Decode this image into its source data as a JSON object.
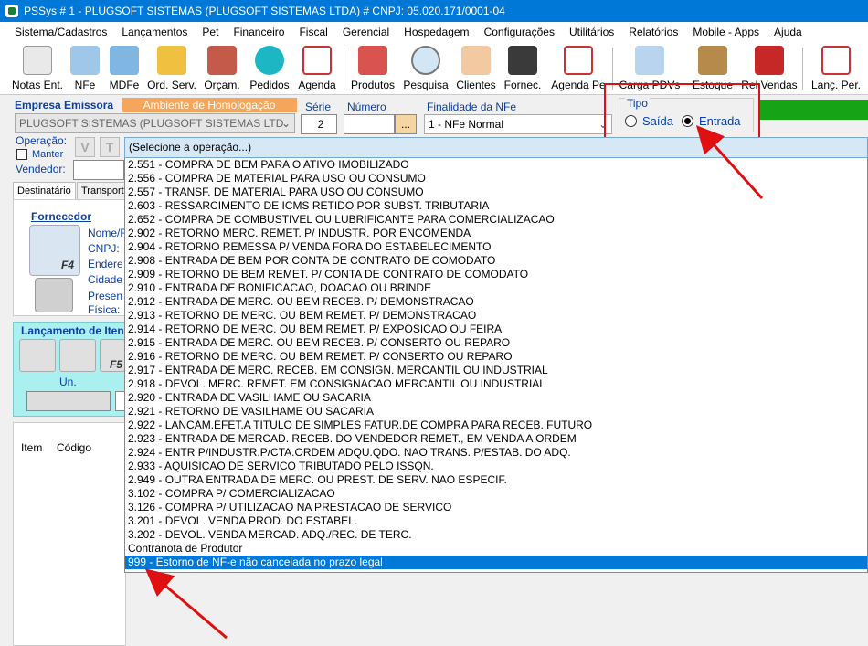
{
  "window": {
    "title": "PSSys # 1 - PLUGSOFT SISTEMAS (PLUGSOFT SISTEMAS LTDA) # CNPJ: 05.020.171/0001-04"
  },
  "menu": [
    "Sistema/Cadastros",
    "Lançamentos",
    "Pet",
    "Financeiro",
    "Fiscal",
    "Gerencial",
    "Hospedagem",
    "Configurações",
    "Utilitários",
    "Relatórios",
    "Mobile - Apps",
    "Ajuda"
  ],
  "toolbar": [
    {
      "label": "Notas Ent.",
      "icon": "notas-entrada-icon"
    },
    {
      "label": "NFe",
      "icon": "nfe-icon"
    },
    {
      "label": "MDFe",
      "icon": "mdfe-icon"
    },
    {
      "label": "Ord. Serv.",
      "icon": "ordem-servico-icon"
    },
    {
      "label": "Orçam.",
      "icon": "orcamento-icon"
    },
    {
      "label": "Pedidos",
      "icon": "pedidos-icon"
    },
    {
      "label": "Agenda",
      "icon": "calendar-icon"
    },
    {
      "label": "Produtos",
      "icon": "cart-icon"
    },
    {
      "label": "Pesquisa",
      "icon": "magnifier-icon"
    },
    {
      "label": "Clientes",
      "icon": "clients-icon"
    },
    {
      "label": "Fornec.",
      "icon": "suppliers-icon"
    },
    {
      "label": "Agenda Pe",
      "icon": "calendar-icon"
    },
    {
      "label": "Carga PDVs",
      "icon": "network-icon"
    },
    {
      "label": "Estoque",
      "icon": "boxes-icon"
    },
    {
      "label": "Rel Vendas",
      "icon": "chart-icon"
    },
    {
      "label": "Lanç. Per.",
      "icon": "calendar-pen-icon"
    }
  ],
  "form": {
    "empresa_label": "Empresa Emissora",
    "ambiente": "Ambiente de Homologação",
    "empresa_value": "PLUGSOFT SISTEMAS  (PLUGSOFT SISTEMAS LTD",
    "serie_label": "Série",
    "serie_value": "2",
    "numero_label": "Número",
    "numero_value": "",
    "numero_btn": "...",
    "finalidade_label": "Finalidade da NFe",
    "finalidade_value": "1 - NFe Normal",
    "tipo_label": "Tipo",
    "tipo_saida": "Saída",
    "tipo_entrada": "Entrada",
    "tipo_selected": "Entrada",
    "operacao_label": "Operação:",
    "manter_label": "Manter",
    "vendedor_label": "Vendedor:",
    "btn_v": "V",
    "btn_t": "T",
    "tab_destinatario": "Destinatário",
    "tab_transport": "Transport",
    "fornecedor_label": "Fornecedor",
    "fields": [
      "Nome/F",
      "CNPJ:",
      "Endere",
      "Cidade",
      "Presen",
      "Física:"
    ],
    "f4_label": "F4",
    "lancamento_label": "Lançamento de Iten",
    "un_label": "Un.",
    "f5_label": "F5",
    "grid_cols": [
      "Item",
      "Código"
    ]
  },
  "dropdown": {
    "header": "(Selecione a operação...)",
    "options": [
      "2.551 - COMPRA DE BEM PARA O ATIVO IMOBILIZADO",
      "2.556 - COMPRA DE MATERIAL PARA USO OU CONSUMO",
      "2.557 - TRANSF. DE MATERIAL PARA USO OU CONSUMO",
      "2.603 - RESSARCIMENTO DE ICMS RETIDO POR SUBST. TRIBUTARIA",
      "2.652 - COMPRA DE COMBUSTIVEL OU LUBRIFICANTE PARA COMERCIALIZACAO",
      "2.902 - RETORNO MERC. REMET. P/ INDUSTR. POR ENCOMENDA",
      "2.904 - RETORNO REMESSA P/ VENDA FORA DO ESTABELECIMENTO",
      "2.908 - ENTRADA DE BEM POR CONTA DE CONTRATO DE COMODATO",
      "2.909 - RETORNO DE BEM REMET. P/ CONTA DE CONTRATO DE COMODATO",
      "2.910 - ENTRADA DE BONIFICACAO, DOACAO OU BRINDE",
      "2.912 - ENTRADA DE MERC. OU BEM RECEB. P/ DEMONSTRACAO",
      "2.913 - RETORNO DE MERC. OU BEM REMET. P/ DEMONSTRACAO",
      "2.914 - RETORNO DE MERC. OU BEM REMET. P/ EXPOSICAO OU FEIRA",
      "2.915 - ENTRADA DE MERC. OU BEM RECEB. P/ CONSERTO OU REPARO",
      "2.916 - RETORNO DE MERC. OU BEM REMET. P/ CONSERTO OU REPARO",
      "2.917 - ENTRADA DE MERC. RECEB. EM CONSIGN. MERCANTIL OU INDUSTRIAL",
      "2.918 - DEVOL. MERC. REMET. EM CONSIGNACAO MERCANTIL OU INDUSTRIAL",
      "2.920 - ENTRADA DE VASILHAME OU SACARIA",
      "2.921 - RETORNO DE VASILHAME OU SACARIA",
      "2.922 - LANCAM.EFET.A TITULO DE SIMPLES FATUR.DE COMPRA PARA RECEB. FUTURO",
      "2.923 - ENTRADA DE MERCAD. RECEB. DO VENDEDOR REMET., EM VENDA A ORDEM",
      "2.924 - ENTR P/INDUSTR.P/CTA.ORDEM ADQU.QDO. NAO TRANS. P/ESTAB. DO ADQ.",
      "2.933 - AQUISICAO DE SERVICO TRIBUTADO PELO ISSQN.",
      "2.949 - OUTRA ENTRADA DE MERC. OU PREST. DE SERV. NAO ESPECIF.",
      "3.102 - COMPRA P/ COMERCIALIZACAO",
      "3.126 - COMPRA P/ UTILIZACAO NA PRESTACAO DE SERVICO",
      "3.201 - DEVOL. VENDA  PROD. DO ESTABEL.",
      "3.202 - DEVOL. VENDA  MERCAD. ADQ./REC. DE TERC.",
      "Contranota de Produtor",
      "999 - Estorno de NF-e não cancelada no prazo legal"
    ],
    "selected_index": 29
  },
  "colors": {
    "titlebar": "#0078d7",
    "selection": "#0078d7",
    "label_blue": "#0a3fa5",
    "annotation_red": "#e01010",
    "ambiente_orange": "#f5a65b",
    "status_green": "#16a316"
  }
}
